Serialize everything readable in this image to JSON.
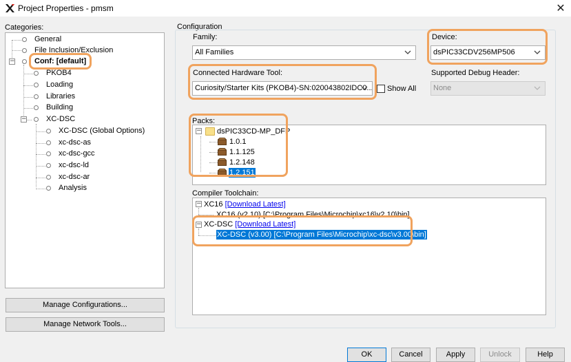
{
  "window": {
    "title": "Project Properties - pmsm",
    "close_symbol": "✕"
  },
  "categories": {
    "label": "Categories:",
    "items": [
      {
        "label": "General"
      },
      {
        "label": "File Inclusion/Exclusion"
      },
      {
        "label": "Conf: [default]"
      },
      {
        "label": "PKOB4"
      },
      {
        "label": "Loading"
      },
      {
        "label": "Libraries"
      },
      {
        "label": "Building"
      },
      {
        "label": "XC-DSC"
      },
      {
        "label": "XC-DSC (Global Options)"
      },
      {
        "label": "xc-dsc-as"
      },
      {
        "label": "xc-dsc-gcc"
      },
      {
        "label": "xc-dsc-ld"
      },
      {
        "label": "xc-dsc-ar"
      },
      {
        "label": "Analysis"
      }
    ],
    "expander_minus": "−"
  },
  "left_buttons": {
    "manage_configurations": "Manage Configurations...",
    "manage_network_tools": "Manage Network Tools..."
  },
  "configuration": {
    "group_label": "Configuration",
    "family_label": "Family:",
    "family_value": "All Families",
    "device_label": "Device:",
    "device_value": "dsPIC33CDV256MP506",
    "hw_tool_label": "Connected Hardware Tool:",
    "hw_tool_value": "Curiosity/Starter Kits (PKOB4)-SN:020043802IDC0...",
    "show_all_label": "Show All",
    "show_all_checked": false,
    "debug_header_label": "Supported Debug Header:",
    "debug_header_value": "None",
    "packs_label": "Packs:",
    "packs_root": "dsPIC33CD-MP_DFP",
    "packs_versions": [
      "1.0.1",
      "1.1.125",
      "1.2.148",
      "1.2.151"
    ],
    "packs_selected_index": 3,
    "toolchain_label": "Compiler Toolchain:",
    "toolchains": [
      {
        "name": "XC16",
        "download": "[Download Latest]",
        "entry": "XC16 (v2.10) [C:\\Program Files\\Microchip\\xc16\\v2.10\\bin]"
      },
      {
        "name": "XC-DSC",
        "download": "[Download Latest]",
        "entry": "XC-DSC (v3.00) [C:\\Program Files\\Microchip\\xc-dsc\\v3.00\\bin]"
      }
    ]
  },
  "bottom_buttons": {
    "ok": "OK",
    "cancel": "Cancel",
    "apply": "Apply",
    "unlock": "Unlock",
    "help": "Help"
  },
  "colors": {
    "highlight": "#f0a35e",
    "selection": "#0078d7",
    "link": "#0000ee",
    "dialog_bg": "#f0f0f0"
  },
  "icons": {
    "app": "mplab-x-icon",
    "node": "circle-node-icon",
    "pack_root": "folder-icon",
    "pack_version": "package-box-icon"
  }
}
